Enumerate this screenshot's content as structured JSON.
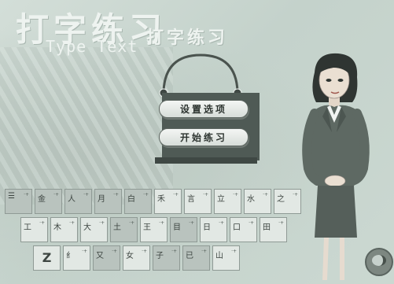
{
  "header": {
    "title_cn": "打字练习",
    "title_en": "Type Text",
    "subtitle_cn": "打字练习"
  },
  "menu": {
    "settings_label": "设置选项",
    "start_label": "开始练习"
  },
  "keyboard": {
    "row1": [
      {
        "ch": "☰",
        "rt": "·+",
        "bm": ""
      },
      {
        "ch": "金",
        "rt": "·+",
        "bm": ""
      },
      {
        "ch": "人",
        "rt": "·+",
        "bm": ""
      },
      {
        "ch": "月",
        "rt": "·+",
        "bm": ""
      },
      {
        "ch": "白",
        "rt": "·+",
        "bm": ""
      },
      {
        "ch": "禾",
        "rt": "·+",
        "bm": ""
      },
      {
        "ch": "言",
        "rt": "·+",
        "bm": ""
      },
      {
        "ch": "立",
        "rt": "·+",
        "bm": ""
      },
      {
        "ch": "水",
        "rt": "·+",
        "bm": ""
      },
      {
        "ch": "之",
        "rt": "·+",
        "bm": ""
      }
    ],
    "row2": [
      {
        "ch": "工",
        "rt": "·+",
        "bm": ""
      },
      {
        "ch": "木",
        "rt": "·+",
        "bm": ""
      },
      {
        "ch": "大",
        "rt": "·+",
        "bm": ""
      },
      {
        "ch": "土",
        "rt": "·+",
        "bm": ""
      },
      {
        "ch": "王",
        "rt": "·+",
        "bm": ""
      },
      {
        "ch": "目",
        "rt": "·+",
        "bm": ""
      },
      {
        "ch": "日",
        "rt": "·+",
        "bm": ""
      },
      {
        "ch": "口",
        "rt": "·+",
        "bm": ""
      },
      {
        "ch": "田",
        "rt": "·+",
        "bm": ""
      }
    ],
    "row3": [
      {
        "ch": "Z",
        "rt": "",
        "bm": ""
      },
      {
        "ch": "纟",
        "rt": "·+",
        "bm": ""
      },
      {
        "ch": "又",
        "rt": "·+",
        "bm": ""
      },
      {
        "ch": "女",
        "rt": "·+",
        "bm": ""
      },
      {
        "ch": "子",
        "rt": "·+",
        "bm": ""
      },
      {
        "ch": "已",
        "rt": "·+",
        "bm": ""
      },
      {
        "ch": "山",
        "rt": "·+",
        "bm": ""
      }
    ]
  },
  "colors": {
    "background": "#c9d7d0",
    "board": "#4f5a55",
    "button_text": "#2d3430",
    "suit": "#5e6963"
  }
}
